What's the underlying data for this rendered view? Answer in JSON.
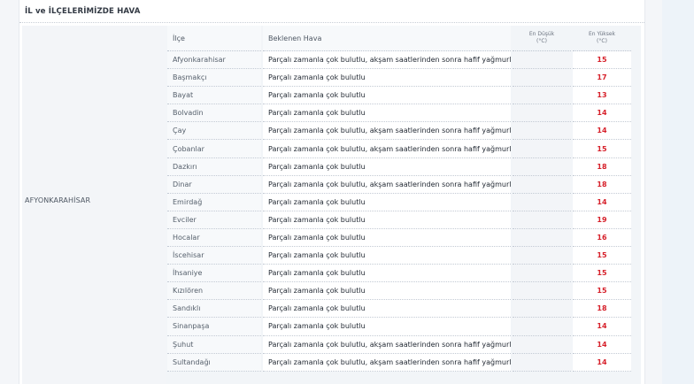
{
  "panel": {
    "title": "İL ve İLÇELERİMİZDE HAVA"
  },
  "province": {
    "name": "AFYONKARAHİSAR"
  },
  "table": {
    "headers": {
      "district": "İlçe",
      "expected_weather": "Beklenen Hava",
      "min_label": "En Düşük",
      "min_unit": "(°C)",
      "max_label": "En Yüksek",
      "max_unit": "(°C)"
    },
    "rows": [
      {
        "district": "Afyonkarahisar",
        "weather": "Parçalı zamanla çok bulutlu, akşam saatlerinden sonra hafif yağmurlu",
        "max": "15"
      },
      {
        "district": "Başmakçı",
        "weather": "Parçalı zamanla çok bulutlu",
        "max": "17"
      },
      {
        "district": "Bayat",
        "weather": "Parçalı zamanla çok bulutlu",
        "max": "13"
      },
      {
        "district": "Bolvadin",
        "weather": "Parçalı zamanla çok bulutlu",
        "max": "14"
      },
      {
        "district": "Çay",
        "weather": "Parçalı zamanla çok bulutlu, akşam saatlerinden sonra hafif yağmurlu",
        "max": "14"
      },
      {
        "district": "Çobanlar",
        "weather": "Parçalı zamanla çok bulutlu, akşam saatlerinden sonra hafif yağmurlu",
        "max": "15"
      },
      {
        "district": "Dazkırı",
        "weather": "Parçalı zamanla çok bulutlu",
        "max": "18"
      },
      {
        "district": "Dinar",
        "weather": "Parçalı zamanla çok bulutlu, akşam saatlerinden sonra hafif yağmurlu",
        "max": "18"
      },
      {
        "district": "Emirdağ",
        "weather": "Parçalı zamanla çok bulutlu",
        "max": "14"
      },
      {
        "district": "Evciler",
        "weather": "Parçalı zamanla çok bulutlu",
        "max": "19"
      },
      {
        "district": "Hocalar",
        "weather": "Parçalı zamanla çok bulutlu",
        "max": "16"
      },
      {
        "district": "İscehisar",
        "weather": "Parçalı zamanla çok bulutlu",
        "max": "15"
      },
      {
        "district": "İhsaniye",
        "weather": "Parçalı zamanla çok bulutlu",
        "max": "15"
      },
      {
        "district": "Kızılören",
        "weather": "Parçalı zamanla çok bulutlu",
        "max": "15"
      },
      {
        "district": "Sandıklı",
        "weather": "Parçalı zamanla çok bulutlu",
        "max": "18"
      },
      {
        "district": "Sinanpaşa",
        "weather": "Parçalı zamanla çok bulutlu",
        "max": "14"
      },
      {
        "district": "Şuhut",
        "weather": "Parçalı zamanla çok bulutlu, akşam saatlerinden sonra hafif yağmurlu",
        "max": "14"
      },
      {
        "district": "Sultandağı",
        "weather": "Parçalı zamanla çok bulutlu, akşam saatlerinden sonra hafif yağmurlu",
        "max": "14"
      }
    ]
  },
  "colors": {
    "max_temp": "#d6202a"
  }
}
